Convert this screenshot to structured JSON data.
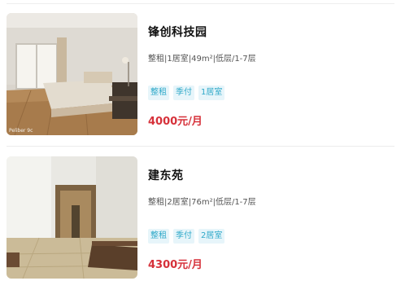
{
  "listings": [
    {
      "title": "锋创科技园",
      "specs": "整租|1居室|49m²|低层/1-7层",
      "tags": [
        "整租",
        "季付",
        "1居室"
      ],
      "price": "4000元/月",
      "photo_caption": "Peliber 9c"
    },
    {
      "title": "建东苑",
      "specs": "整租|2居室|76m²|低层/1-7层",
      "tags": [
        "整租",
        "季付",
        "2居室"
      ],
      "price": "4300元/月"
    }
  ],
  "colors": {
    "price": "#d6313a",
    "tag_text": "#2fa9c9",
    "tag_bg": "#e7f5fa"
  }
}
